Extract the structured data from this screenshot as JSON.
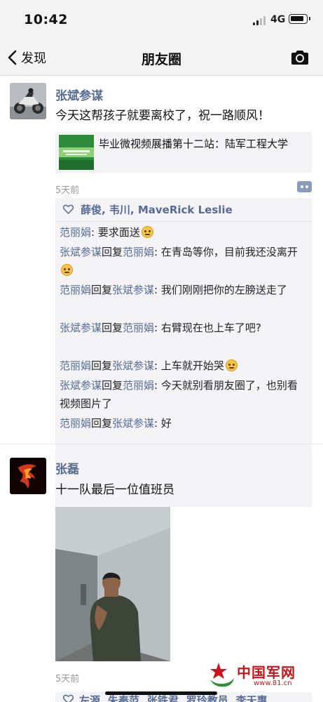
{
  "status_bar": {
    "time": "10:42",
    "network": "4G"
  },
  "nav": {
    "back_label": "发现",
    "title": "朋友圈"
  },
  "posts": [
    {
      "author": "张斌参谋",
      "text": "今天这帮孩子就要离校了，祝一路顺风！",
      "link": {
        "title": "毕业微视频展播第十二站：陆军工程大学"
      },
      "time_ago": "5天前",
      "likes": "薛俊, 韦川, MaveRick Leslie",
      "comments": [
        {
          "from": "范丽娟",
          "to": "",
          "reply": "",
          "text": ": 要求面送",
          "emoji": true
        },
        {
          "from": "张斌参谋",
          "reply": "回复",
          "to": "范丽娟",
          "text": ": 在青岛等你，目前我还没离开",
          "emoji": true
        },
        {
          "from": "范丽娟",
          "reply": "回复",
          "to": "张斌参谋",
          "text": ": 我们刚刚把你的左膀送走了",
          "emoji": false
        },
        {
          "from": "张斌参谋",
          "reply": "回复",
          "to": "范丽娟",
          "text": ": 右臂现在也上车了吧?",
          "emoji": false
        },
        {
          "from": "范丽娟",
          "reply": "回复",
          "to": "张斌参谋",
          "text": ": 上车就开始哭",
          "emoji": true
        },
        {
          "from": "张斌参谋",
          "reply": "回复",
          "to": "范丽娟",
          "text": ": 今天就别看朋友圈了，也别看视频图片了",
          "emoji": false
        },
        {
          "from": "范丽娟",
          "reply": "回复",
          "to": "张斌参谋",
          "text": ": 好",
          "emoji": false
        }
      ]
    },
    {
      "author": "张磊",
      "text": "十一队最后一位值班员",
      "time_ago": "5天前",
      "likes": "左源, 朱秦范, 张铁君, 罗玲教员, 李天惠"
    }
  ],
  "watermark": {
    "name": "中国军网",
    "url": "www.81.cn"
  },
  "colors": {
    "link_blue": "#576b95",
    "bar_bg": "#f3f3f3",
    "card_bg": "#f3f3f5"
  }
}
